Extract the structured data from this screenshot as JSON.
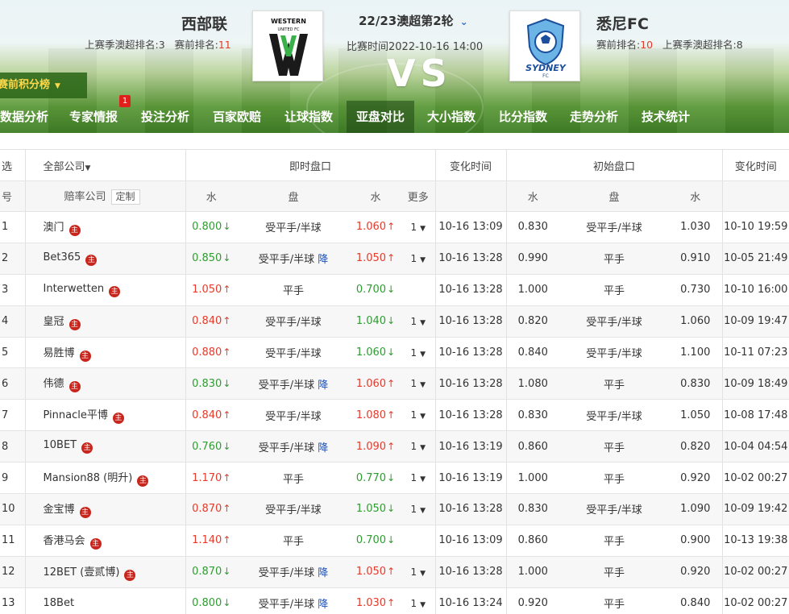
{
  "home": {
    "name": "西部联",
    "last_rank_label": "上赛季澳超排名:",
    "last_rank": "3",
    "pre_rank_label": "赛前排名:",
    "pre_rank": "11",
    "logo_text": "WESTERN UNITED FC"
  },
  "away": {
    "name": "悉尼FC",
    "pre_rank_label": "赛前排名:",
    "pre_rank": "10",
    "last_rank_label": "上赛季澳超排名:",
    "last_rank": "8",
    "logo_text": "SYDNEY FC"
  },
  "match": {
    "round": "22/23澳超第2轮",
    "time_label": "比赛时间",
    "time": "2022-10-16 14:00",
    "vs": "VS"
  },
  "standings_btn": "赛前积分榜",
  "nav": [
    {
      "label": "数据分析"
    },
    {
      "label": "专家情报",
      "badge": "1"
    },
    {
      "label": "投注分析"
    },
    {
      "label": "百家欧赔"
    },
    {
      "label": "让球指数"
    },
    {
      "label": "亚盘对比",
      "active": true
    },
    {
      "label": "大小指数"
    },
    {
      "label": "比分指数"
    },
    {
      "label": "走势分析"
    },
    {
      "label": "技术统计"
    }
  ],
  "table": {
    "header1": {
      "select": "选",
      "all_companies": "全部公司",
      "live": "即时盘口",
      "change_time": "变化时间",
      "initial": "初始盘口",
      "change_time2": "变化时间"
    },
    "header2": {
      "no": "号",
      "company": "赔率公司",
      "custom": "定制",
      "water1": "水",
      "handicap": "盘",
      "water2": "水",
      "more": "更多",
      "iwater1": "水",
      "ihandicap": "盘",
      "iwater2": "水"
    },
    "rows": [
      {
        "no": "1",
        "company": "澳门",
        "main": true,
        "w1": "0.800",
        "w1d": "down",
        "h": "受平手/半球",
        "drop": "",
        "w2": "1.060",
        "w2d": "up",
        "more": "1",
        "t": "10-16 13:09",
        "iw1": "0.830",
        "ih": "受平手/半球",
        "iw2": "1.030",
        "it": "10-10 19:59"
      },
      {
        "no": "2",
        "company": "Bet365",
        "main": true,
        "w1": "0.850",
        "w1d": "down",
        "h": "受平手/半球",
        "drop": "降",
        "w2": "1.050",
        "w2d": "up",
        "more": "1",
        "t": "10-16 13:28",
        "iw1": "0.990",
        "ih": "平手",
        "iw2": "0.910",
        "it": "10-05 21:49"
      },
      {
        "no": "3",
        "company": "Interwetten",
        "main": true,
        "w1": "1.050",
        "w1d": "up",
        "h": "平手",
        "drop": "",
        "w2": "0.700",
        "w2d": "down",
        "more": "",
        "t": "10-16 13:28",
        "iw1": "1.000",
        "ih": "平手",
        "iw2": "0.730",
        "it": "10-10 16:00"
      },
      {
        "no": "4",
        "company": "皇冠",
        "main": true,
        "w1": "0.840",
        "w1d": "up",
        "h": "受平手/半球",
        "drop": "",
        "w2": "1.040",
        "w2d": "down",
        "more": "1",
        "t": "10-16 13:28",
        "iw1": "0.820",
        "ih": "受平手/半球",
        "iw2": "1.060",
        "it": "10-09 19:47"
      },
      {
        "no": "5",
        "company": "易胜博",
        "main": true,
        "w1": "0.880",
        "w1d": "up",
        "h": "受平手/半球",
        "drop": "",
        "w2": "1.060",
        "w2d": "down",
        "more": "1",
        "t": "10-16 13:28",
        "iw1": "0.840",
        "ih": "受平手/半球",
        "iw2": "1.100",
        "it": "10-11 07:23"
      },
      {
        "no": "6",
        "company": "伟德",
        "main": true,
        "w1": "0.830",
        "w1d": "down",
        "h": "受平手/半球",
        "drop": "降",
        "w2": "1.060",
        "w2d": "up",
        "more": "1",
        "t": "10-16 13:28",
        "iw1": "1.080",
        "ih": "平手",
        "iw2": "0.830",
        "it": "10-09 18:49"
      },
      {
        "no": "7",
        "company": "Pinnacle平博",
        "main": true,
        "w1": "0.840",
        "w1d": "up",
        "h": "受平手/半球",
        "drop": "",
        "w2": "1.080",
        "w2d": "up",
        "more": "1",
        "t": "10-16 13:28",
        "iw1": "0.830",
        "ih": "受平手/半球",
        "iw2": "1.050",
        "it": "10-08 17:48"
      },
      {
        "no": "8",
        "company": "10BET",
        "main": true,
        "w1": "0.760",
        "w1d": "down",
        "h": "受平手/半球",
        "drop": "降",
        "w2": "1.090",
        "w2d": "up",
        "more": "1",
        "t": "10-16 13:19",
        "iw1": "0.860",
        "ih": "平手",
        "iw2": "0.820",
        "it": "10-04 04:54"
      },
      {
        "no": "9",
        "company": "Mansion88 (明升)",
        "main": true,
        "w1": "1.170",
        "w1d": "up",
        "h": "平手",
        "drop": "",
        "w2": "0.770",
        "w2d": "down",
        "more": "1",
        "t": "10-16 13:19",
        "iw1": "1.000",
        "ih": "平手",
        "iw2": "0.920",
        "it": "10-02 00:27"
      },
      {
        "no": "10",
        "company": "金宝博",
        "main": true,
        "w1": "0.870",
        "w1d": "up",
        "h": "受平手/半球",
        "drop": "",
        "w2": "1.050",
        "w2d": "down",
        "more": "1",
        "t": "10-16 13:28",
        "iw1": "0.830",
        "ih": "受平手/半球",
        "iw2": "1.090",
        "it": "10-09 19:42"
      },
      {
        "no": "11",
        "company": "香港马会",
        "main": true,
        "w1": "1.140",
        "w1d": "up",
        "h": "平手",
        "drop": "",
        "w2": "0.700",
        "w2d": "down",
        "more": "",
        "t": "10-16 13:09",
        "iw1": "0.860",
        "ih": "平手",
        "iw2": "0.900",
        "it": "10-13 19:38"
      },
      {
        "no": "12",
        "company": "12BET (壹贰博)",
        "main": true,
        "w1": "0.870",
        "w1d": "down",
        "h": "受平手/半球",
        "drop": "降",
        "w2": "1.050",
        "w2d": "up",
        "more": "1",
        "t": "10-16 13:28",
        "iw1": "1.000",
        "ih": "平手",
        "iw2": "0.920",
        "it": "10-02 00:27"
      },
      {
        "no": "13",
        "company": "18Bet",
        "main": false,
        "w1": "0.800",
        "w1d": "down",
        "h": "受平手/半球",
        "drop": "降",
        "w2": "1.030",
        "w2d": "up",
        "more": "1",
        "t": "10-16 13:24",
        "iw1": "0.920",
        "ih": "平手",
        "iw2": "0.840",
        "it": "10-02 00:27"
      }
    ]
  },
  "symbols": {
    "up": "↑",
    "down": "↓",
    "main_badge": "主"
  },
  "colors": {
    "up": "#e43b2c",
    "down": "#2f9c31",
    "accent_blue": "#1d53bf",
    "badge_red": "#c8261d"
  }
}
